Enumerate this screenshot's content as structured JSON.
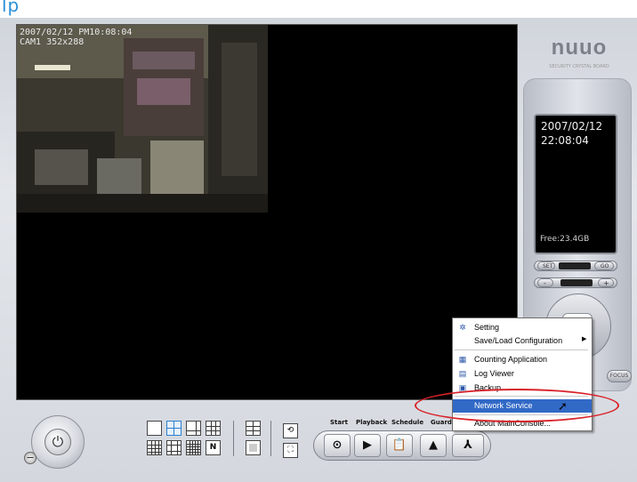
{
  "caption": {
    "text": "lp"
  },
  "video": {
    "osd_date": "2007/02/12 PM10:08:04",
    "osd_camera": "CAM1 352x288"
  },
  "brand": {
    "logo": "nuuo",
    "subtitle": "SECURITY CRYSTAL BOARD"
  },
  "info_panel": {
    "date": "2007/02/12",
    "time": "22:08:04",
    "free": "Free:23.4GB"
  },
  "panel_controls": {
    "set_label": "SET",
    "go_label": "GO",
    "minus_label": "-",
    "plus_label": "+",
    "focus_label": "FOCUS"
  },
  "bottom_nav": {
    "items": [
      {
        "label": "Start",
        "icon": "record-icon"
      },
      {
        "label": "Playback",
        "icon": "playback-icon"
      },
      {
        "label": "Schedule",
        "icon": "schedule-icon"
      },
      {
        "label": "Guard",
        "icon": "guard-warning-icon"
      },
      {
        "label": "",
        "icon": "tools-icon"
      }
    ]
  },
  "context_menu": {
    "items": [
      {
        "label": "Setting",
        "icon": "gear-icon"
      },
      {
        "label": "Save/Load Configuration",
        "icon": "",
        "submenu": true
      },
      {
        "label": "Counting Application",
        "icon": "counting-icon"
      },
      {
        "label": "Log Viewer",
        "icon": "log-icon"
      },
      {
        "label": "Backup",
        "icon": "backup-icon"
      },
      {
        "label": "Network Service",
        "icon": "",
        "highlighted": true
      },
      {
        "label": "About MainConsole...",
        "icon": ""
      }
    ]
  },
  "colors": {
    "menu_highlight": "#3169c6",
    "annotation_ellipse": "#d8232a",
    "layout_selected": "#2b7fd0"
  }
}
